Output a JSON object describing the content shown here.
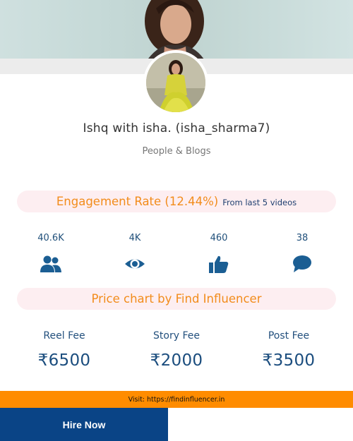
{
  "profile": {
    "name": "Ishq with isha. (isha_sharma7)",
    "category": "People & Blogs"
  },
  "engagement": {
    "title": "Engagement Rate (12.44%)",
    "subtitle": "From last 5 videos"
  },
  "stats": [
    {
      "value": "40.6K",
      "icon": "users-icon"
    },
    {
      "value": "4K",
      "icon": "eye-icon"
    },
    {
      "value": "460",
      "icon": "thumbs-up-icon"
    },
    {
      "value": "38",
      "icon": "comment-icon"
    }
  ],
  "price_chart": {
    "title": "Price chart by Find Influencer",
    "fees": [
      {
        "label": "Reel Fee",
        "amount": "₹6500"
      },
      {
        "label": "Story Fee",
        "amount": "₹2000"
      },
      {
        "label": "Post Fee",
        "amount": "₹3500"
      }
    ]
  },
  "footer": {
    "visit_text": "Visit: https://findinfluencer.in",
    "hire_label": "Hire Now"
  },
  "colors": {
    "accent_orange": "#f28c1b",
    "visit_bar": "#ff8c00",
    "hire_button": "#0a4486",
    "pill_bg": "#fdeef1",
    "icon_blue": "#1b5e93"
  }
}
